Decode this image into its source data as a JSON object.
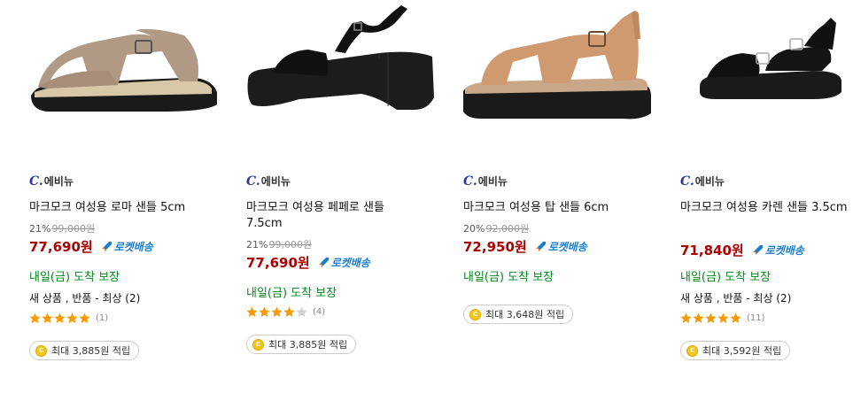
{
  "products": [
    {
      "brand": "에비뉴",
      "title": "마크모크 여성용 로마 샌들 5cm",
      "discount": "21%",
      "original_price": "99,000원",
      "price": "77,690원",
      "rocket": "로켓배송",
      "delivery": "내일(금) 도착 보장",
      "condition": "새 상품 , 반품 - 최상 (2)",
      "rating": 5,
      "review_count": "(1)",
      "reward": "최대 3,885원 적립",
      "shoe_color": "#b09a85"
    },
    {
      "brand": "에비뉴",
      "title": "마크모크 여성용 페페로 샌들 7.5cm",
      "discount": "21%",
      "original_price": "99,000원",
      "price": "77,690원",
      "rocket": "로켓배송",
      "delivery": "내일(금) 도착 보장",
      "condition": "",
      "rating": 4,
      "review_count": "(4)",
      "reward": "최대 3,885원 적립",
      "shoe_color": "#1c1c1c"
    },
    {
      "brand": "에비뉴",
      "title": "마크모크 여성용 탑 샌들 6cm",
      "discount": "20%",
      "original_price": "92,000원",
      "price": "72,950원",
      "rocket": "로켓배송",
      "delivery": "내일(금) 도착 보장",
      "condition": "",
      "rating": 0,
      "review_count": "",
      "reward": "최대 3,648원 적립",
      "shoe_color": "#d09a70"
    },
    {
      "brand": "에비뉴",
      "title": "마크모크 여성용 카렌 샌들 3.5cm",
      "discount": "",
      "original_price": "",
      "price": "71,840원",
      "rocket": "로켓배송",
      "delivery": "내일(금) 도착 보장",
      "condition": "새 상품 , 반품 - 최상 (2)",
      "rating": 5,
      "review_count": "(11)",
      "reward": "최대 3,592원 적립",
      "shoe_color": "#1a1a1a"
    }
  ],
  "colors": {
    "price": "#ae0000",
    "delivery": "#00891a",
    "rocket": "#1a7fd0",
    "star": "#f59a00"
  }
}
